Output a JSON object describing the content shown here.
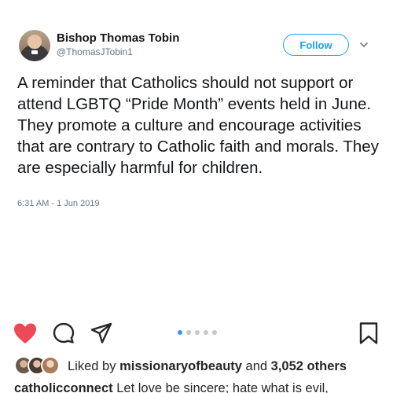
{
  "tweet": {
    "author_name": "Bishop Thomas Tobin",
    "author_handle": "@ThomasJTobin1",
    "follow_label": "Follow",
    "text": "A reminder that Catholics should not support or attend LGBTQ “Pride Month” events held in June. They promote a culture and encourage activities that are contrary to Catholic faith and morals. They are especially harmful for children.",
    "timestamp": "6:31 AM - 1 Jun 2019",
    "accent_color": "#1da1f2"
  },
  "post": {
    "icons": [
      "heart-icon",
      "comment-icon",
      "share-icon",
      "bookmark-icon"
    ],
    "heart_color": "#ed4956",
    "carousel": {
      "total": 5,
      "active": 1,
      "active_color": "#3897f0"
    },
    "liked_by_prefix": "Liked by",
    "liked_by_user": "missionaryofbeauty",
    "liked_by_and": "and",
    "liked_by_count": "3,052 others",
    "caption_user": "catholicconnect",
    "caption_text": "Let love be sincere; hate what is evil,"
  }
}
